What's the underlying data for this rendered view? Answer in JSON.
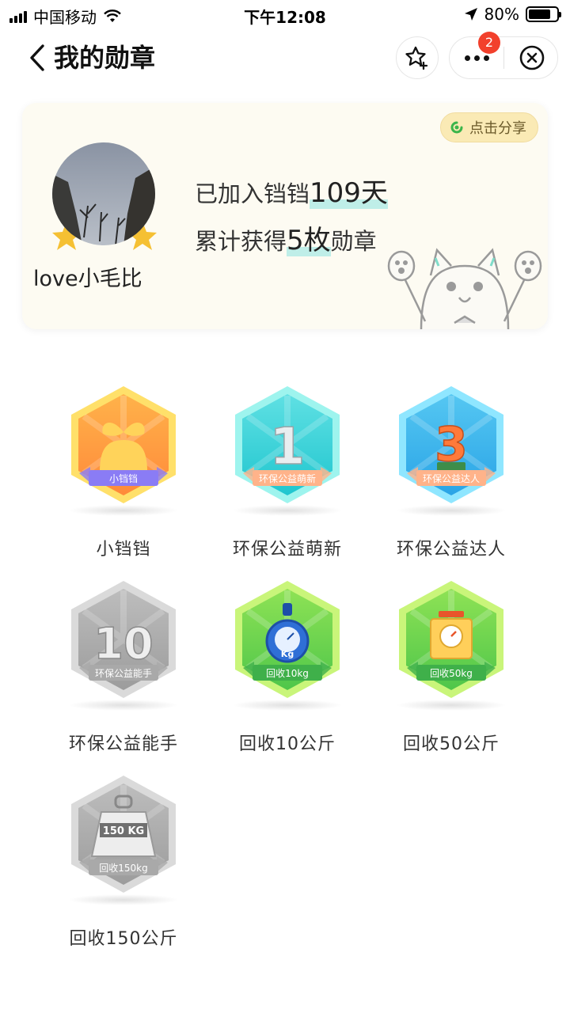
{
  "status_bar": {
    "carrier": "中国移动",
    "time": "下午12:08",
    "battery": "80%",
    "battery_level": 0.8
  },
  "nav": {
    "title": "我的勋章",
    "more_badge_count": "2"
  },
  "profile": {
    "username": "love小毛比",
    "share_label": "点击分享",
    "joined_prefix": "已加入铛铛",
    "joined_days": "109天",
    "badges_prefix": "累计获得",
    "badges_count": "5枚",
    "badges_suffix": "勋章"
  },
  "badges": [
    {
      "name": "小铛铛",
      "ribbon": "小铛铛",
      "style": "orange",
      "earned": true
    },
    {
      "name": "环保公益萌新",
      "ribbon": "环保公益萌新",
      "glyph": "1",
      "style": "cyan",
      "earned": true
    },
    {
      "name": "环保公益达人",
      "ribbon": "环保公益达人",
      "glyph": "3",
      "style": "blue",
      "earned": true
    },
    {
      "name": "环保公益能手",
      "ribbon": "环保公益能手",
      "glyph": "10",
      "style": "gray",
      "earned": false
    },
    {
      "name": "回收10公斤",
      "ribbon": "回收10kg",
      "glyph": "Kg",
      "style": "green",
      "earned": true
    },
    {
      "name": "回收50公斤",
      "ribbon": "回收50kg",
      "style": "green",
      "earned": true
    },
    {
      "name": "回收150公斤",
      "ribbon": "回收150kg",
      "glyph": "150 KG",
      "style": "gray",
      "earned": false
    }
  ],
  "colors": {
    "card_bg": "#fdfbf2",
    "share_bg": "#faeab5",
    "highlight": "#bfeee8",
    "badge_red": "#f2402c"
  }
}
